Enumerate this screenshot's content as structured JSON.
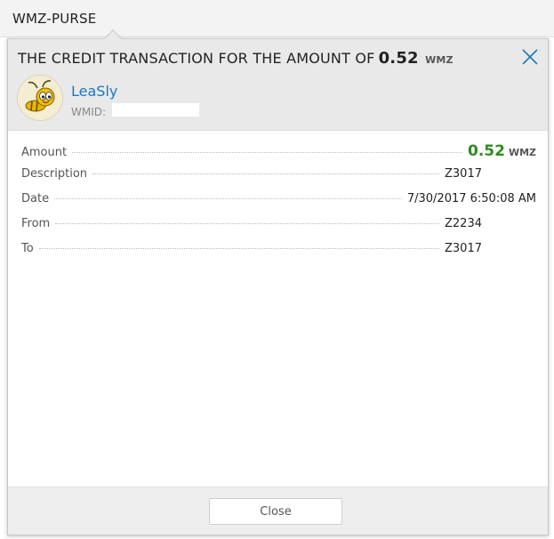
{
  "tab": {
    "title": "WMZ-PURSE"
  },
  "dialog": {
    "title_text": "THE CREDIT TRANSACTION FOR THE AMOUNT OF",
    "title_amount": "0.52",
    "title_currency": "WMZ",
    "user": {
      "name": "LeaSly",
      "wmid_label": "WMID:"
    },
    "rows": [
      {
        "label": "Amount",
        "value": "0.52",
        "currency": "WMZ"
      },
      {
        "label": "Description",
        "value": "Z3017"
      },
      {
        "label": "Date",
        "value": "7/30/2017 6:50:08 AM"
      },
      {
        "label": "From",
        "value": "Z2234"
      },
      {
        "label": "To",
        "value": "Z3017"
      }
    ],
    "footer": {
      "close_label": "Close"
    }
  },
  "colors": {
    "accent_blue": "#1a78c2",
    "amount_green": "#2e8b1f",
    "header_bg": "#e9e9e9"
  },
  "icons": {
    "close": "close-icon",
    "avatar": "bee-avatar-icon"
  }
}
